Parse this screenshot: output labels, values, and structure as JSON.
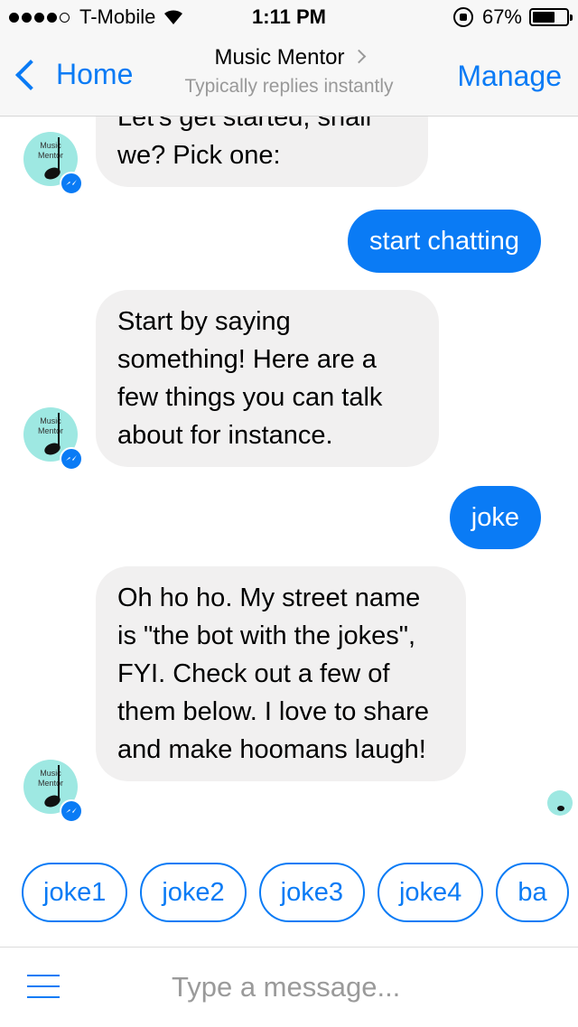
{
  "status_bar": {
    "carrier": "T-Mobile",
    "time": "1:11 PM",
    "battery": "67%",
    "battery_level": 0.67,
    "signal_icon": "signal-dots-icon",
    "wifi_icon": "wifi-icon",
    "rotation_lock_icon": "rotation-lock-icon"
  },
  "nav": {
    "back_label": "Home",
    "title": "Music Mentor",
    "subtitle": "Typically replies instantly",
    "action_label": "Manage"
  },
  "colors": {
    "accent": "#0a7bf5",
    "bot_bubble": "#f1f0f0",
    "avatar_bg": "#9ee8e2"
  },
  "avatar_label": "Music Mentor",
  "messages": [
    {
      "sender": "bot",
      "text": "Let's get started, shall we? Pick one:"
    },
    {
      "sender": "user",
      "text": "start chatting"
    },
    {
      "sender": "bot",
      "text": "Start by saying something! Here are a few things you can talk about for instance."
    },
    {
      "sender": "user",
      "text": "joke"
    },
    {
      "sender": "bot",
      "text": "Oh ho ho. My street name is \"the bot with the jokes\", FYI. Check out a few of them below. I love to share and make hoomans laugh!"
    }
  ],
  "quick_replies": [
    "joke1",
    "joke2",
    "joke3",
    "joke4",
    "ba"
  ],
  "composer": {
    "placeholder": "Type a message...",
    "menu_icon": "hamburger-menu-icon"
  }
}
